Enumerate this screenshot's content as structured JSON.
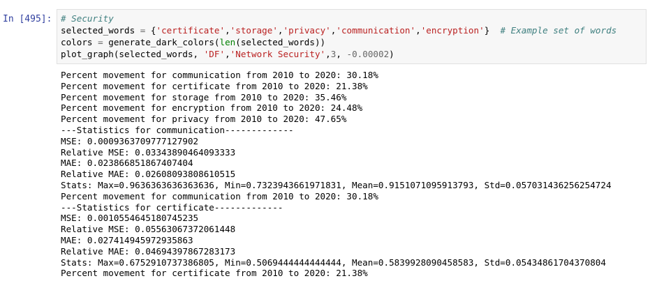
{
  "cell": {
    "prompt": "In [495]:",
    "code": {
      "line1": {
        "comment": "# Security"
      },
      "line2": {
        "var": "selected_words ",
        "op1": "=",
        "open": " {",
        "s1": "'certificate'",
        "s2": "'storage'",
        "s3": "'privacy'",
        "s4": "'communication'",
        "s5": "'encryption'",
        "close": "}  ",
        "comment": "# Example set of words"
      },
      "line3": {
        "var": "colors ",
        "op1": "=",
        "func": " generate_dark_colors(",
        "builtin": "len",
        "rest": "(selected_words))"
      },
      "line4": {
        "func": "plot_graph(selected_words, ",
        "s1": "'DF'",
        "s2": "'Network Security'",
        "n1": "3",
        "n2": "-0.00002",
        "end": ")"
      }
    },
    "output": [
      "Percent movement for communication from 2010 to 2020: 30.18%",
      "Percent movement for certificate from 2010 to 2020: 21.38%",
      "Percent movement for storage from 2010 to 2020: 35.46%",
      "Percent movement for encryption from 2010 to 2020: 24.48%",
      "Percent movement for privacy from 2010 to 2020: 47.65%",
      "---Statistics for communication-------------",
      "MSE: 0.0009363709777127902",
      "Relative MSE: 0.03343890464093333",
      "MAE: 0.023866851867407404",
      "Relative MAE: 0.02608093808610515",
      "Stats: Max=0.9636363636363636, Min=0.7323943661971831, Mean=0.9151071095913793, Std=0.057031436256254724",
      "Percent movement for communication from 2010 to 2020: 30.18%",
      "---Statistics for certificate-------------",
      "MSE: 0.0010554645180745235",
      "Relative MSE: 0.05563067372061448",
      "MAE: 0.027414945972935863",
      "Relative MAE: 0.04694397867283173",
      "Stats: Max=0.6752910737386805, Min=0.5069444444444444, Mean=0.5839928090458583, Std=0.05434861704370804",
      "Percent movement for certificate from 2010 to 2020: 21.38%"
    ]
  }
}
